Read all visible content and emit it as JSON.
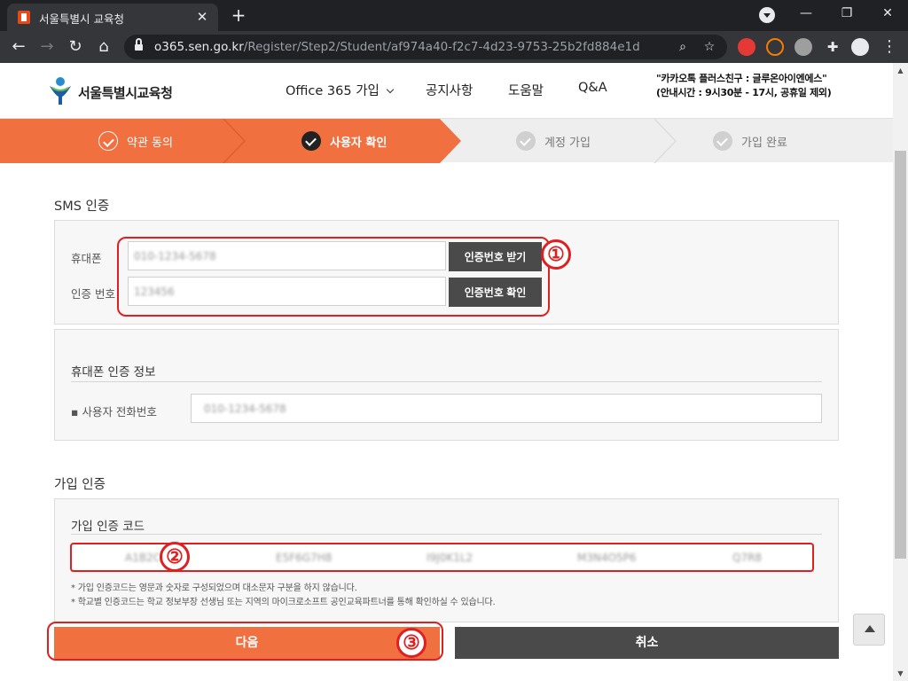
{
  "browser": {
    "tab_title": "서울특별시 교육청",
    "tab_close": "✕",
    "new_tab": "+",
    "url_host": "o365.sen.go.kr",
    "url_path": "/Register/Step2/Student/af974a40-f2c7-4d23-9753-25b2fd884e1d",
    "window": {
      "minimize": "—",
      "restore": "❐",
      "close": "✕"
    }
  },
  "header": {
    "logo_text": "서울특별시교육청",
    "nav": [
      {
        "label": "Office 365 가입"
      },
      {
        "label": "공지사항"
      },
      {
        "label": "도움말"
      },
      {
        "label": "Q&A"
      }
    ],
    "kakao_line1": "\"카카오톡 플러스친구 : 글루온아이엔에스\"",
    "kakao_line2": "(안내시간 : 9시30분 - 17시, 공휴일 제외)"
  },
  "steps": [
    {
      "label": "약관 동의",
      "state": "done"
    },
    {
      "label": "사용자 확인",
      "state": "current"
    },
    {
      "label": "계정 가입",
      "state": "todo"
    },
    {
      "label": "가입 완료",
      "state": "todo"
    }
  ],
  "colors": {
    "accent": "#f07040",
    "dark": "#4a4a4a",
    "annotation": "#e02020"
  },
  "sms": {
    "title": "SMS 인증",
    "phone_label": "휴대폰",
    "phone_value": "010-1234-5678",
    "code_label": "인증 번호",
    "code_value": "123456",
    "get_code_button": "인증번호 받기",
    "verify_button": "인증번호 확인"
  },
  "phone_info": {
    "title": "휴대폰 인증 정보",
    "user_phone_label": "사용자 전화번호",
    "user_phone_value": "010-1234-5678"
  },
  "join": {
    "title": "가입 인증",
    "code_title": "가입 인증 코드",
    "code_segments": [
      "A1B2C3D4",
      "E5F6G7H8",
      "I9J0K1L2",
      "M3N4O5P6",
      "Q7R8"
    ],
    "note1": "* 가입 인증코드는 영문과 숫자로 구성되었으며 대소문자 구분을 하지 않습니다.",
    "note2": "* 학교별 인증코드는 학교 정보부장 선생님 또는 지역의 마이크로소프트 공인교육파트너를 통해 확인하실 수 있습니다."
  },
  "buttons": {
    "next": "다음",
    "cancel": "취소"
  },
  "annotations": [
    "①",
    "②",
    "③"
  ]
}
